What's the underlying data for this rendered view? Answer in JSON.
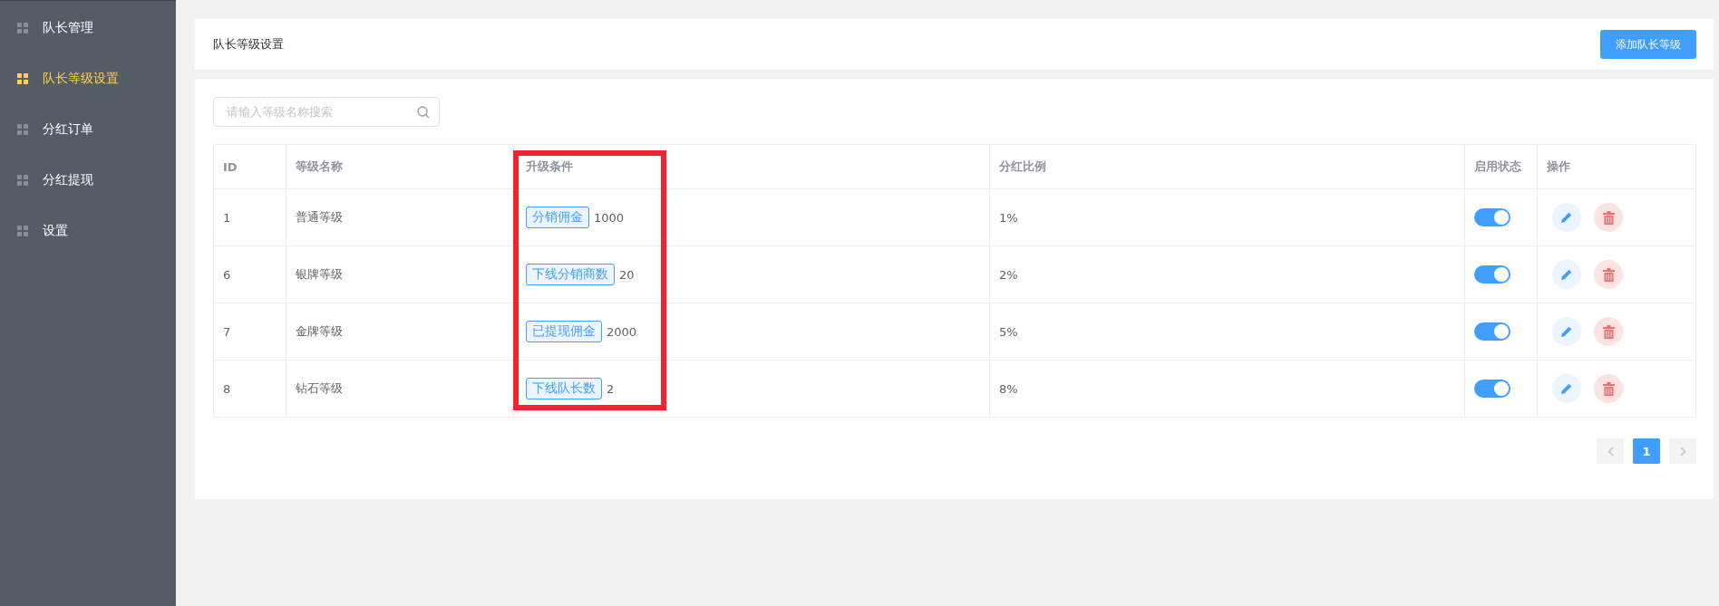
{
  "sidebar": {
    "items": [
      {
        "label": "队长管理",
        "selected": false
      },
      {
        "label": "队长等级设置",
        "selected": true
      },
      {
        "label": "分红订单",
        "selected": false
      },
      {
        "label": "分红提现",
        "selected": false
      },
      {
        "label": "设置",
        "selected": false
      }
    ]
  },
  "header": {
    "title": "队长等级设置",
    "add_button": "添加队长等级"
  },
  "search": {
    "placeholder": "请输入等级名称搜索"
  },
  "table": {
    "columns": [
      {
        "label": "ID",
        "highlighted": false
      },
      {
        "label": "等级名称",
        "highlighted": false
      },
      {
        "label": "升级条件",
        "highlighted": true
      },
      {
        "label": "分红比例",
        "highlighted": false
      },
      {
        "label": "启用状态",
        "highlighted": false
      },
      {
        "label": "操作",
        "highlighted": false
      }
    ],
    "rows": [
      {
        "id": "1",
        "name": "普通等级",
        "condition_tag": "分销佣金",
        "condition_value": "1000",
        "ratio": "1%",
        "on": true
      },
      {
        "id": "6",
        "name": "银牌等级",
        "condition_tag": "下线分销商数",
        "condition_value": "20",
        "ratio": "2%",
        "on": true
      },
      {
        "id": "7",
        "name": "金牌等级",
        "condition_tag": "已提现佣金",
        "condition_value": "2000",
        "ratio": "5%",
        "on": true
      },
      {
        "id": "8",
        "name": "钻石等级",
        "condition_tag": "下线队长数",
        "condition_value": "2",
        "ratio": "8%",
        "on": true
      }
    ]
  },
  "pagination": {
    "pages": [
      {
        "label": "1",
        "selected": true
      }
    ]
  }
}
